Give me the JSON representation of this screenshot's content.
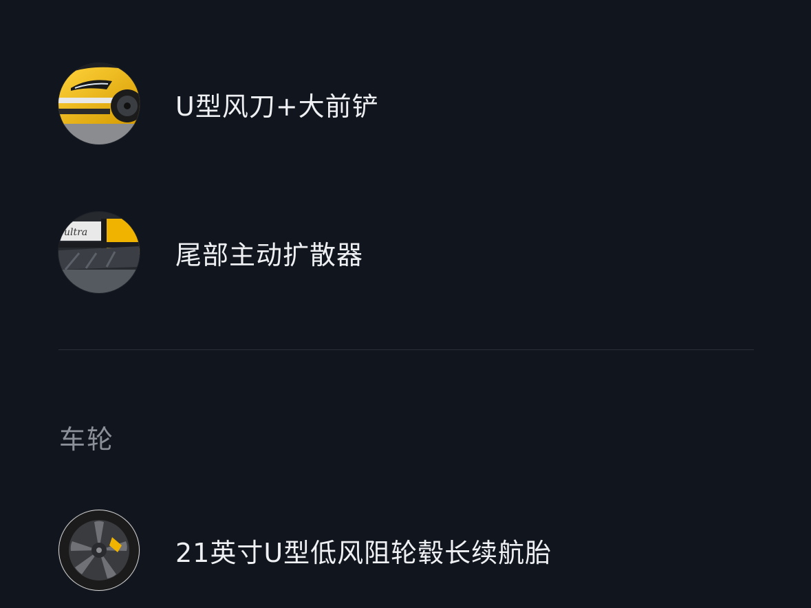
{
  "features": [
    {
      "label": "U型风刀+大前铲",
      "icon": "car-front-thumbnail-icon"
    },
    {
      "label": "尾部主动扩散器",
      "icon": "rear-diffuser-thumbnail-icon"
    }
  ],
  "wheel_section": {
    "title": "车轮",
    "items": [
      {
        "label": "21英寸U型低风阻轮毂长续航胎",
        "icon": "wheel-thumbnail-icon"
      }
    ]
  },
  "colors": {
    "background": "#11151d",
    "text_primary": "#eef0f3",
    "text_secondary": "#8a8f98",
    "divider": "#2a2f38",
    "accent_yellow": "#f0b400"
  }
}
